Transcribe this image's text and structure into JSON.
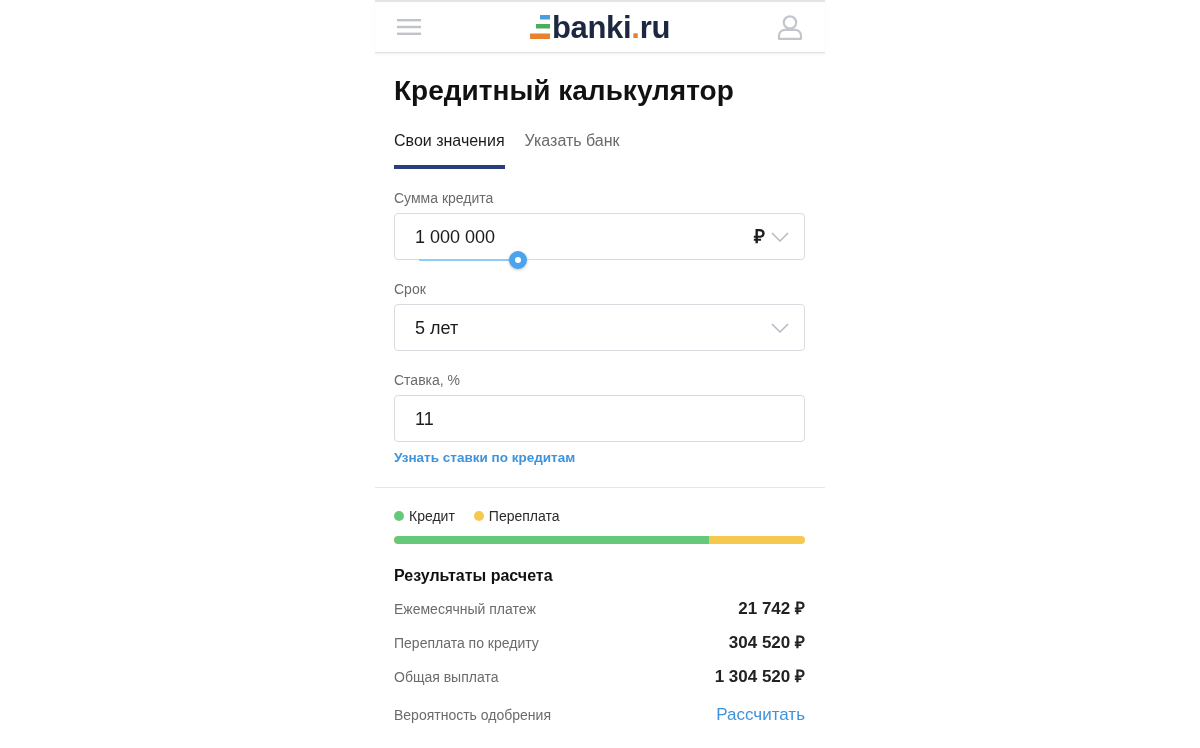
{
  "header": {
    "logo": {
      "parts": [
        "banki",
        ".",
        "ru"
      ]
    }
  },
  "title": "Кредитный калькулятор",
  "tabs": [
    {
      "label": "Свои значения",
      "selected": true
    },
    {
      "label": "Указать банк",
      "selected": false
    }
  ],
  "fields": [
    {
      "kind": "amount",
      "label": "Сумма кредита",
      "value": "1 000 000",
      "currency": "₽",
      "slider": {
        "level": 0.27
      }
    },
    {
      "kind": "select",
      "label": "Срок",
      "value": "5 лет"
    },
    {
      "kind": "text",
      "label": "Ставка, %",
      "value": "11"
    }
  ],
  "rates_link": "Узнать ставки по кредитам",
  "legend": [
    {
      "label": "Кредит",
      "color": "#66c97a"
    },
    {
      "label": "Переплата",
      "color": "#f5c94e"
    }
  ],
  "share_bar": {
    "level": 0.767
  },
  "results": {
    "title": "Результаты расчета",
    "rows": [
      {
        "kind": "value",
        "label": "Ежемесячный платеж",
        "value": "21 742 ₽"
      },
      {
        "kind": "value",
        "label": "Переплата по кредиту",
        "value": "304 520 ₽"
      },
      {
        "kind": "value",
        "label": "Общая выплата",
        "value": "1 304 520 ₽"
      },
      {
        "kind": "link",
        "label": "Вероятность одобрения",
        "value": "Рассчитать"
      }
    ]
  }
}
